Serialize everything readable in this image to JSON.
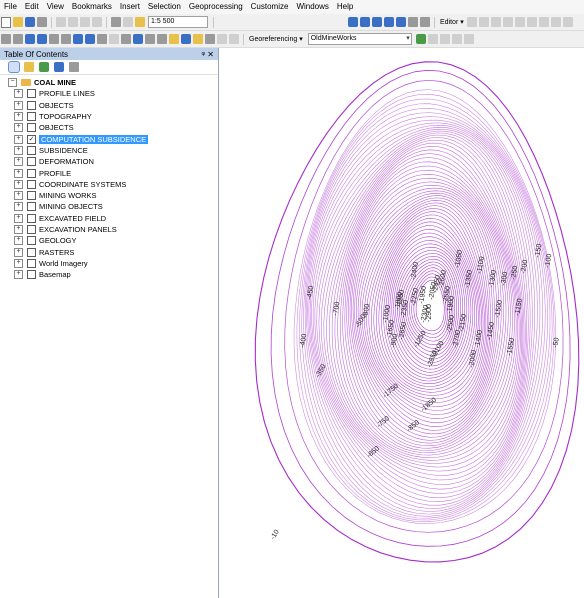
{
  "menu": [
    "File",
    "Edit",
    "View",
    "Bookmarks",
    "Insert",
    "Selection",
    "Geoprocessing",
    "Customize",
    "Windows",
    "Help"
  ],
  "toolbar": {
    "scale_value": "1:5 500",
    "editor_label": "Editor ▾",
    "georeferencing_label": "Georeferencing ▾",
    "layer_combo_value": "OldMineWorks"
  },
  "toc": {
    "title": "Table Of Contents",
    "pin": "ᵠ ✕",
    "group_name": "COAL MINE",
    "layers": [
      {
        "name": "PROFILE LINES",
        "checked": false,
        "selected": false
      },
      {
        "name": "OBJECTS",
        "checked": false,
        "selected": false
      },
      {
        "name": "TOPOGRAPHY",
        "checked": false,
        "selected": false
      },
      {
        "name": "OBJECTS",
        "checked": false,
        "selected": false
      },
      {
        "name": "COMPUTATION SUBSIDENCE",
        "checked": true,
        "selected": true
      },
      {
        "name": "SUBSIDENCE",
        "checked": false,
        "selected": false
      },
      {
        "name": "DEFORMATION",
        "checked": false,
        "selected": false
      },
      {
        "name": "PROFILE",
        "checked": false,
        "selected": false
      },
      {
        "name": "COORDINATE SYSTEMS",
        "checked": false,
        "selected": false
      },
      {
        "name": "MINING WORKS",
        "checked": false,
        "selected": false
      },
      {
        "name": "MINING OBJECTS",
        "checked": false,
        "selected": false
      },
      {
        "name": "EXCAVATED FIELD",
        "checked": false,
        "selected": false
      },
      {
        "name": "EXCAVATION PANELS",
        "checked": false,
        "selected": false
      },
      {
        "name": "GEOLOGY",
        "checked": false,
        "selected": false
      },
      {
        "name": "RASTERS",
        "checked": false,
        "selected": false
      },
      {
        "name": "World Imagery",
        "checked": false,
        "selected": false
      },
      {
        "name": "Basemap",
        "checked": false,
        "selected": false
      }
    ]
  },
  "map": {
    "contour_color": "#a020c8",
    "labels": [
      "-10",
      "-50",
      "-100",
      "-150",
      "-200",
      "-250",
      "-300",
      "-350",
      "-400",
      "-450",
      "-500",
      "-650",
      "-700",
      "-750",
      "-800",
      "-850",
      "-900",
      "-1000",
      "-1050",
      "-1100",
      "-1150",
      "-1200",
      "-1250",
      "-1300",
      "-1350",
      "-1400",
      "-1450",
      "-1500",
      "-1550",
      "-1650",
      "-1750",
      "-1800",
      "-1850",
      "-1900",
      "-1950",
      "-2000",
      "-2050",
      "-2100",
      "-2150",
      "-2250",
      "-2300",
      "-2350",
      "-2400",
      "-2450",
      "-2500",
      "-2550",
      "-2600",
      "-2650",
      "-2700",
      "-2850",
      "-2900"
    ]
  }
}
